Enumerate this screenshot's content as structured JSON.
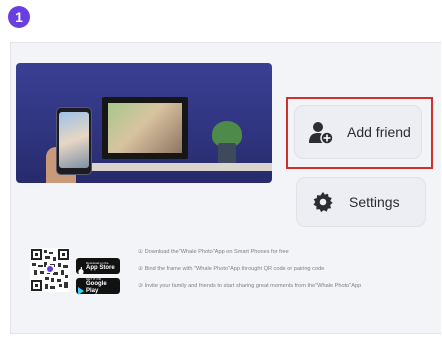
{
  "step_number": "1",
  "buttons": {
    "add_friend": {
      "label": "Add friend",
      "icon": "add-person-icon"
    },
    "settings": {
      "label": "Settings",
      "icon": "gear-icon"
    }
  },
  "downloads": {
    "qr_icon": "qr-code-icon",
    "app_store": {
      "small": "Download on the",
      "big": "App Store"
    },
    "google_play": {
      "small": "GET IT ON",
      "big": "Google Play"
    }
  },
  "instructions": [
    "① Download the\"Whale Photo\"App on Smart Phones for free",
    "② Bind the frame with \"Whale Photo\"App throught QR code or pairing code",
    "③ Invite your family and friends to start sharing great moments from the\"Whale Photo\"App"
  ],
  "colors": {
    "badge": "#6a3fe0",
    "highlight": "#d0312d",
    "hero_bg": "#2f347f",
    "button_bg": "#eceef3"
  }
}
